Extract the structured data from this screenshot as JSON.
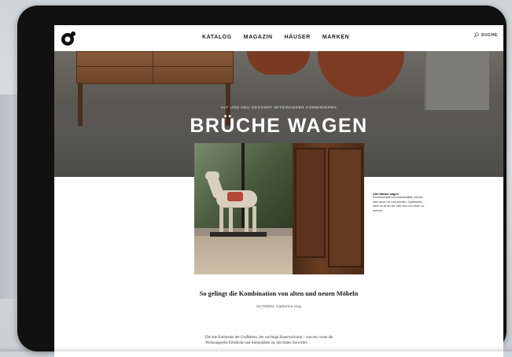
{
  "nav": {
    "items": [
      "KATALOG",
      "MAGAZIN",
      "HÄUSER",
      "MARKEN"
    ],
    "search_label": "SUCHE"
  },
  "hero": {
    "kicker": "ALT UND NEU GEKONNT MITEINANDER KOMBINIEREN",
    "title": "BRÜCHE WAGEN"
  },
  "side_note": {
    "title": "Alte Möbel sagen",
    "text": "Persönlichkeit und Individualität, können aber auch zur Last werden. Spätestens dann ist es an der Zeit, sich von ihnen zu trennen."
  },
  "article": {
    "subtitle": "So gelingt die Kombination von alten und neuen Möbeln",
    "author": "AUTORIN: Catherine Hug",
    "body": "Die alte Kommode der Großeltern, der wuchtige Bauernschrank – was tun, wenn die Wohnungserbe Erbstücke und Antiquitäten ist, mit denen Sie nichts"
  },
  "colors": {
    "tablet_frame": "#111111",
    "hero_bg": "#5b5854",
    "text_dark": "#1b1b1b"
  }
}
